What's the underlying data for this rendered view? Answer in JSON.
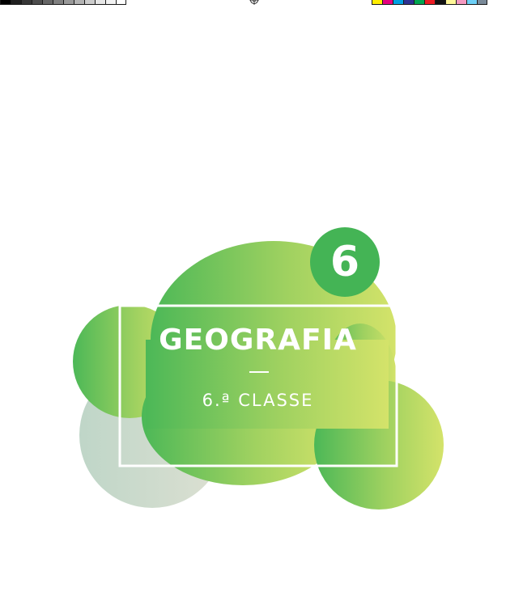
{
  "cover": {
    "subject": "GEOGRAFIA",
    "grade_label": "6.ª CLASSE",
    "grade_number": "6"
  },
  "print_marks": {
    "grayscale_swatches": [
      "#000000",
      "#1f1f1f",
      "#363636",
      "#4d4d4d",
      "#666666",
      "#808080",
      "#999999",
      "#b3b3b3",
      "#cccccc",
      "#e6e6e6",
      "#f2f2f2",
      "#ffffff"
    ],
    "color_swatches": [
      "#ffed00",
      "#e6007e",
      "#00a0e3",
      "#2e3192",
      "#00a651",
      "#ed1c24",
      "#111111",
      "#fff799",
      "#f49ac1",
      "#6dcff6",
      "#7a8a99"
    ]
  },
  "colors": {
    "blob_green_dark": "#4cb857",
    "blob_green_light": "#d4e36a",
    "blob_gray_left": "#bfd6c8",
    "blob_gray_right": "#d8ddd0",
    "badge_green": "#44b455",
    "frame": "#ffffff"
  }
}
